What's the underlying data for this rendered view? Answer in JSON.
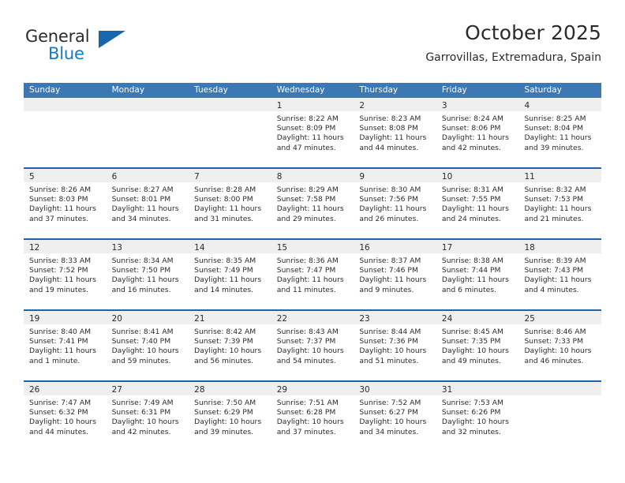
{
  "brand": {
    "name_part1": "General",
    "name_part2": "Blue",
    "triangle_color": "#1667ad",
    "blue_color": "#1679c4"
  },
  "header": {
    "title": "October 2025",
    "subtitle": "Garrovillas, Extremadura, Spain"
  },
  "theme": {
    "header_blue": "#3b78b4",
    "separator_blue": "#1f64a8",
    "daynum_band": "#efefef",
    "text": "#2b2b2b"
  },
  "weekdays": [
    "Sunday",
    "Monday",
    "Tuesday",
    "Wednesday",
    "Thursday",
    "Friday",
    "Saturday"
  ],
  "labels": {
    "sunrise_prefix": "Sunrise:",
    "sunset_prefix": "Sunset:",
    "daylight_prefix": "Daylight:"
  },
  "weeks": [
    [
      {
        "day": "",
        "empty": true
      },
      {
        "day": "",
        "empty": true
      },
      {
        "day": "",
        "empty": true
      },
      {
        "day": "1",
        "sunrise": "Sunrise: 8:22 AM",
        "sunset": "Sunset: 8:09 PM",
        "daylight": "Daylight: 11 hours and 47 minutes."
      },
      {
        "day": "2",
        "sunrise": "Sunrise: 8:23 AM",
        "sunset": "Sunset: 8:08 PM",
        "daylight": "Daylight: 11 hours and 44 minutes."
      },
      {
        "day": "3",
        "sunrise": "Sunrise: 8:24 AM",
        "sunset": "Sunset: 8:06 PM",
        "daylight": "Daylight: 11 hours and 42 minutes."
      },
      {
        "day": "4",
        "sunrise": "Sunrise: 8:25 AM",
        "sunset": "Sunset: 8:04 PM",
        "daylight": "Daylight: 11 hours and 39 minutes."
      }
    ],
    [
      {
        "day": "5",
        "sunrise": "Sunrise: 8:26 AM",
        "sunset": "Sunset: 8:03 PM",
        "daylight": "Daylight: 11 hours and 37 minutes."
      },
      {
        "day": "6",
        "sunrise": "Sunrise: 8:27 AM",
        "sunset": "Sunset: 8:01 PM",
        "daylight": "Daylight: 11 hours and 34 minutes."
      },
      {
        "day": "7",
        "sunrise": "Sunrise: 8:28 AM",
        "sunset": "Sunset: 8:00 PM",
        "daylight": "Daylight: 11 hours and 31 minutes."
      },
      {
        "day": "8",
        "sunrise": "Sunrise: 8:29 AM",
        "sunset": "Sunset: 7:58 PM",
        "daylight": "Daylight: 11 hours and 29 minutes."
      },
      {
        "day": "9",
        "sunrise": "Sunrise: 8:30 AM",
        "sunset": "Sunset: 7:56 PM",
        "daylight": "Daylight: 11 hours and 26 minutes."
      },
      {
        "day": "10",
        "sunrise": "Sunrise: 8:31 AM",
        "sunset": "Sunset: 7:55 PM",
        "daylight": "Daylight: 11 hours and 24 minutes."
      },
      {
        "day": "11",
        "sunrise": "Sunrise: 8:32 AM",
        "sunset": "Sunset: 7:53 PM",
        "daylight": "Daylight: 11 hours and 21 minutes."
      }
    ],
    [
      {
        "day": "12",
        "sunrise": "Sunrise: 8:33 AM",
        "sunset": "Sunset: 7:52 PM",
        "daylight": "Daylight: 11 hours and 19 minutes."
      },
      {
        "day": "13",
        "sunrise": "Sunrise: 8:34 AM",
        "sunset": "Sunset: 7:50 PM",
        "daylight": "Daylight: 11 hours and 16 minutes."
      },
      {
        "day": "14",
        "sunrise": "Sunrise: 8:35 AM",
        "sunset": "Sunset: 7:49 PM",
        "daylight": "Daylight: 11 hours and 14 minutes."
      },
      {
        "day": "15",
        "sunrise": "Sunrise: 8:36 AM",
        "sunset": "Sunset: 7:47 PM",
        "daylight": "Daylight: 11 hours and 11 minutes."
      },
      {
        "day": "16",
        "sunrise": "Sunrise: 8:37 AM",
        "sunset": "Sunset: 7:46 PM",
        "daylight": "Daylight: 11 hours and 9 minutes."
      },
      {
        "day": "17",
        "sunrise": "Sunrise: 8:38 AM",
        "sunset": "Sunset: 7:44 PM",
        "daylight": "Daylight: 11 hours and 6 minutes."
      },
      {
        "day": "18",
        "sunrise": "Sunrise: 8:39 AM",
        "sunset": "Sunset: 7:43 PM",
        "daylight": "Daylight: 11 hours and 4 minutes."
      }
    ],
    [
      {
        "day": "19",
        "sunrise": "Sunrise: 8:40 AM",
        "sunset": "Sunset: 7:41 PM",
        "daylight": "Daylight: 11 hours and 1 minute."
      },
      {
        "day": "20",
        "sunrise": "Sunrise: 8:41 AM",
        "sunset": "Sunset: 7:40 PM",
        "daylight": "Daylight: 10 hours and 59 minutes."
      },
      {
        "day": "21",
        "sunrise": "Sunrise: 8:42 AM",
        "sunset": "Sunset: 7:39 PM",
        "daylight": "Daylight: 10 hours and 56 minutes."
      },
      {
        "day": "22",
        "sunrise": "Sunrise: 8:43 AM",
        "sunset": "Sunset: 7:37 PM",
        "daylight": "Daylight: 10 hours and 54 minutes."
      },
      {
        "day": "23",
        "sunrise": "Sunrise: 8:44 AM",
        "sunset": "Sunset: 7:36 PM",
        "daylight": "Daylight: 10 hours and 51 minutes."
      },
      {
        "day": "24",
        "sunrise": "Sunrise: 8:45 AM",
        "sunset": "Sunset: 7:35 PM",
        "daylight": "Daylight: 10 hours and 49 minutes."
      },
      {
        "day": "25",
        "sunrise": "Sunrise: 8:46 AM",
        "sunset": "Sunset: 7:33 PM",
        "daylight": "Daylight: 10 hours and 46 minutes."
      }
    ],
    [
      {
        "day": "26",
        "sunrise": "Sunrise: 7:47 AM",
        "sunset": "Sunset: 6:32 PM",
        "daylight": "Daylight: 10 hours and 44 minutes."
      },
      {
        "day": "27",
        "sunrise": "Sunrise: 7:49 AM",
        "sunset": "Sunset: 6:31 PM",
        "daylight": "Daylight: 10 hours and 42 minutes."
      },
      {
        "day": "28",
        "sunrise": "Sunrise: 7:50 AM",
        "sunset": "Sunset: 6:29 PM",
        "daylight": "Daylight: 10 hours and 39 minutes."
      },
      {
        "day": "29",
        "sunrise": "Sunrise: 7:51 AM",
        "sunset": "Sunset: 6:28 PM",
        "daylight": "Daylight: 10 hours and 37 minutes."
      },
      {
        "day": "30",
        "sunrise": "Sunrise: 7:52 AM",
        "sunset": "Sunset: 6:27 PM",
        "daylight": "Daylight: 10 hours and 34 minutes."
      },
      {
        "day": "31",
        "sunrise": "Sunrise: 7:53 AM",
        "sunset": "Sunset: 6:26 PM",
        "daylight": "Daylight: 10 hours and 32 minutes."
      },
      {
        "day": "",
        "empty": true
      }
    ]
  ]
}
